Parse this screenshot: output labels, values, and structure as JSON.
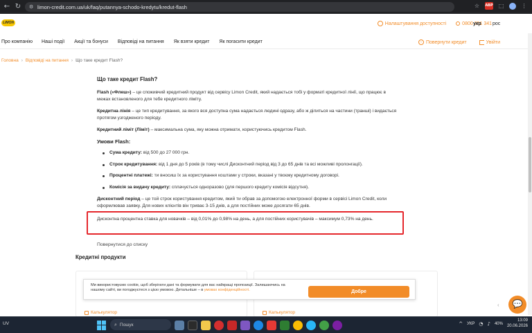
{
  "browser": {
    "url": "limon-credit.com.ua/uk/faq/putannya-schodo-kredytu/kredut-flash"
  },
  "header": {
    "logo_text": "LIMON",
    "accessibility_label": "Налаштування доступності",
    "phone": "0800 351 341",
    "lang_ukr": "укр",
    "lang_ros": "рос"
  },
  "nav": {
    "items": [
      "Про компанію",
      "Наші події",
      "Акції та бонуси",
      "Відповіді на питання",
      "Як взяти кредит",
      "Як погасити кредит"
    ],
    "return_credit": "Повернути кредит",
    "login": "Увійти"
  },
  "breadcrumb": {
    "home": "Головна",
    "faq": "Відповіді на питання",
    "current": "Що таке кредит Flash?"
  },
  "article": {
    "title": "Що таке кредит Flash?",
    "p1_bold": "Flash («Флеш»)",
    "p1": " – це споживчий кредитний продукт від сервісу Limon Credit, який надається тобі у форматі кредитної лінії, що працює в межах встановленого для тебе кредитного ліміту.",
    "p2_bold": "Кредитна лінія",
    "p2": " – це тип кредитування, за якого вся доступна сума надається людині одразу, або ж ділиться на частини (транші) і видається протягом узгодженого періоду.",
    "p3_bold": "Кредитний ліміт (Ліміт)",
    "p3": " – максимальна сума, яку можна отримати, користуючись кредитом Flash.",
    "conditions_title": "Умови Flash:",
    "conditions": [
      {
        "label": "Сума кредиту:",
        "text": " від 500 до 27 000 грн."
      },
      {
        "label": "Строк кредитування:",
        "text": " від 1 дня до 5 років (в тому числі Дисконтний період від 3 до 65 днів та всі можливі пролонгації)."
      },
      {
        "label": "Процентні платежі:",
        "text": " ти вносиш їх за користування коштами у строки, вказані у твоєму кредитному договорі."
      },
      {
        "label": "Комісія за видачу кредиту:",
        "text": " сплачується одноразово (для першого кредиту комісія відсутня)."
      }
    ],
    "p4_bold": "Дисконтний період",
    "p4": " – це той строк користування кредитом, який ти обрав за допомогою електронної форми в сервісі Limon Credit, коли оформлював заявку. Для нових клієнтів він триває 3-15 днів, а для постійних може досягати 65 днів.",
    "highlight": "Дисконтна процентна ставка для новачків – від 0,01% до 0,98% на день, а для постійних користувачів – максимум 0,73% на день."
  },
  "back_to_list": "Повернутися до списку",
  "products_title": "Кредитні продукти",
  "cards": {
    "calc_label": "Калькулятор"
  },
  "cookie": {
    "text": "Ми використовуємо cookie, щоб зберігати дані та формувати для вас найкращі пропозиції. Залишаючись на нашому сайті, ви погоджуєтеся з цією умовою. Детальніше – в ",
    "link": "умовах конфіденційності.",
    "button": "Добре"
  },
  "taskbar": {
    "weather": "UV",
    "search": "Пошук",
    "lang": "УКР",
    "battery": "40%",
    "time": "13:09",
    "date": "20.06.2026"
  },
  "colors": {
    "accent": "#f28c28",
    "highlight_border": "#e5262b",
    "logo": "#f7c600"
  }
}
